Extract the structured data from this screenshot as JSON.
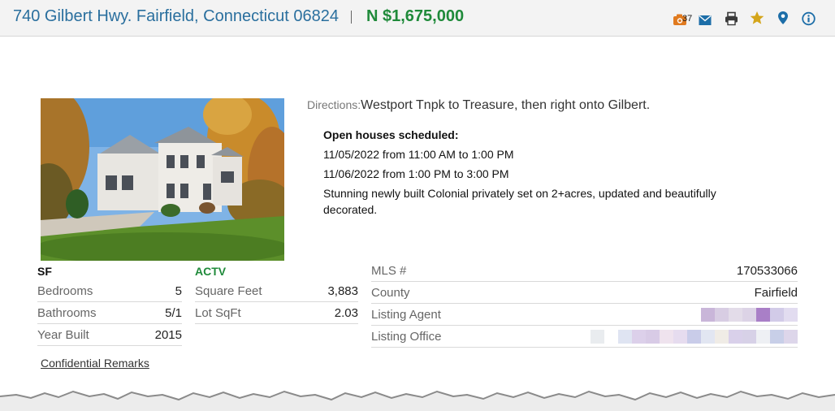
{
  "header": {
    "address": "740 Gilbert Hwy. Fairfield, Connecticut 06824",
    "price": "N $1,675,000",
    "photo_count": "37",
    "icons": [
      "camera-icon",
      "envelope-icon",
      "print-icon",
      "star-icon",
      "map-pin-icon",
      "info-icon"
    ]
  },
  "details": {
    "directions_label": "Directions:",
    "directions": "Westport Tnpk to Treasure, then right onto Gilbert.",
    "open_houses_title": "Open houses scheduled:",
    "open_houses": [
      "11/05/2022 from 11:00 AM to 1:00 PM",
      "11/06/2022 from 1:00 PM to 3:00 PM"
    ],
    "remarks": "Stunning newly built Colonial privately set on 2+acres, updated and beautifully decorated."
  },
  "facts_left": {
    "heading": "SF",
    "rows": [
      {
        "label": "Bedrooms",
        "value": "5"
      },
      {
        "label": "Bathrooms",
        "value": "5/1"
      },
      {
        "label": "Year Built",
        "value": "2015"
      }
    ]
  },
  "facts_mid": {
    "heading": "ACTV",
    "rows": [
      {
        "label": "Square Feet",
        "value": "3,883"
      },
      {
        "label": "Lot SqFt",
        "value": "2.03"
      }
    ]
  },
  "facts_right": {
    "rows": [
      {
        "label": "MLS #",
        "value": "170533066"
      },
      {
        "label": "County",
        "value": "Fairfield"
      },
      {
        "label": "Listing Agent",
        "value": ""
      },
      {
        "label": "Listing Office",
        "value": ""
      }
    ]
  },
  "links": {
    "confidential_remarks": "Confidential Remarks"
  },
  "colors": {
    "address": "#2a6f9e",
    "price": "#1f8a3a",
    "status": "#1f8a3a",
    "icon_blue": "#1d6ea8",
    "star": "#d4a51a",
    "camera": "#e07a1f"
  }
}
